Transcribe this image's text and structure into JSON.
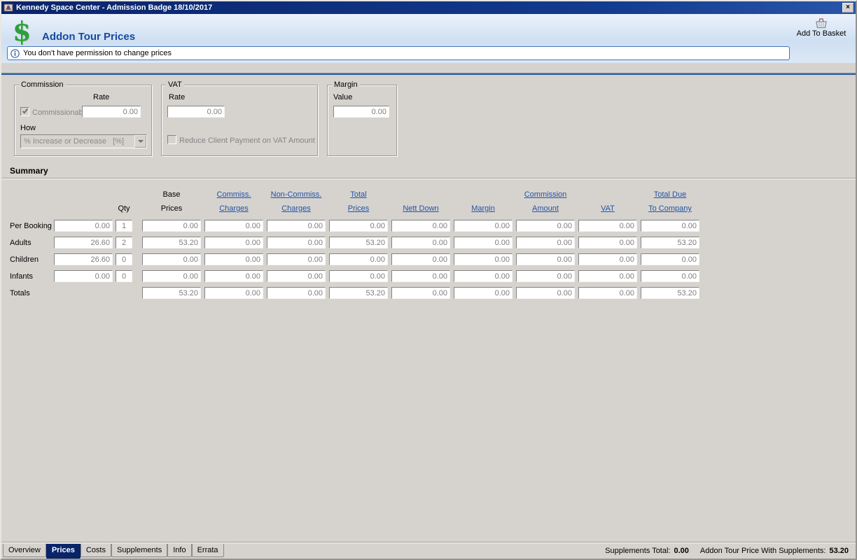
{
  "window": {
    "title": "Kennedy Space Center - Admission Badge 18/10/2017",
    "close_glyph": "×"
  },
  "header": {
    "dollar_glyph": "$",
    "title": "Addon Tour Prices",
    "add_to_basket": "Add To Basket",
    "info_message": "You don't have permission to change prices"
  },
  "groups": {
    "commission": {
      "title": "Commission",
      "rate_label": "Rate",
      "rate_value": "0.00",
      "commissionable_label": "Commissionable",
      "how_label": "How",
      "how_value": "% Increase or Decrease   [%]"
    },
    "vat": {
      "title": "VAT",
      "rate_label": "Rate",
      "rate_value": "0.00",
      "reduce_label": "Reduce Client Payment on VAT Amount"
    },
    "margin": {
      "title": "Margin",
      "value_label": "Value",
      "value": "0.00"
    }
  },
  "summary": {
    "title": "Summary",
    "headers": {
      "qty": "Qty",
      "base_top": "Base",
      "base_bottom": "Prices",
      "commiss_top": "Commiss.",
      "commiss_bottom": "Charges",
      "non_commiss_top": "Non-Commiss.",
      "non_commiss_bottom": "Charges",
      "total_top": "Total",
      "total_bottom": "Prices",
      "nett_down": "Nett Down",
      "margin": "Margin",
      "commission_top": "Commission",
      "commission_bottom": "Amount",
      "vat": "VAT",
      "total_due_top": "Total Due",
      "total_due_bottom": "To Company"
    },
    "rows": [
      {
        "label": "Per Booking",
        "price": "0.00",
        "qty": "1",
        "base": "0.00",
        "commiss": "0.00",
        "non_commiss": "0.00",
        "total": "0.00",
        "nett_down": "0.00",
        "margin": "0.00",
        "commission": "0.00",
        "vat": "0.00",
        "total_due": "0.00"
      },
      {
        "label": "Adults",
        "price": "26.60",
        "qty": "2",
        "base": "53.20",
        "commiss": "0.00",
        "non_commiss": "0.00",
        "total": "53.20",
        "nett_down": "0.00",
        "margin": "0.00",
        "commission": "0.00",
        "vat": "0.00",
        "total_due": "53.20"
      },
      {
        "label": "Children",
        "price": "26.60",
        "qty": "0",
        "base": "0.00",
        "commiss": "0.00",
        "non_commiss": "0.00",
        "total": "0.00",
        "nett_down": "0.00",
        "margin": "0.00",
        "commission": "0.00",
        "vat": "0.00",
        "total_due": "0.00"
      },
      {
        "label": "Infants",
        "price": "0.00",
        "qty": "0",
        "base": "0.00",
        "commiss": "0.00",
        "non_commiss": "0.00",
        "total": "0.00",
        "nett_down": "0.00",
        "margin": "0.00",
        "commission": "0.00",
        "vat": "0.00",
        "total_due": "0.00"
      }
    ],
    "totals": {
      "label": "Totals",
      "base": "53.20",
      "commiss": "0.00",
      "non_commiss": "0.00",
      "total": "53.20",
      "nett_down": "0.00",
      "margin": "0.00",
      "commission": "0.00",
      "vat": "0.00",
      "total_due": "53.20"
    }
  },
  "tabs": [
    {
      "label": "Overview"
    },
    {
      "label": "Prices"
    },
    {
      "label": "Costs"
    },
    {
      "label": "Supplements"
    },
    {
      "label": "Info"
    },
    {
      "label": "Errata"
    }
  ],
  "status": {
    "supplements_total_label": "Supplements Total:",
    "supplements_total_value": "0.00",
    "addon_price_label": "Addon Tour Price With Supplements:",
    "addon_price_value": "53.20"
  }
}
